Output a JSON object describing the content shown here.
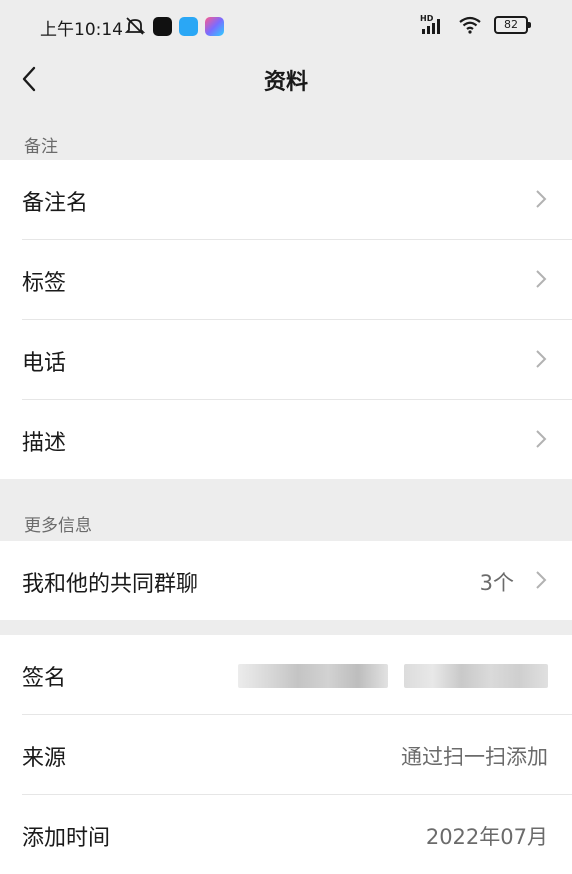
{
  "status": {
    "time": "上午10:14",
    "network": "HD",
    "battery": "82"
  },
  "nav": {
    "title": "资料"
  },
  "section_remark": {
    "header": "备注",
    "items": [
      {
        "label": "备注名"
      },
      {
        "label": "标签"
      },
      {
        "label": "电话"
      },
      {
        "label": "描述"
      }
    ]
  },
  "section_more": {
    "header": "更多信息",
    "common_groups": {
      "label": "我和他的共同群聊",
      "value": "3个"
    }
  },
  "section_info": {
    "signature": {
      "label": "签名"
    },
    "source": {
      "label": "来源",
      "value": "通过扫一扫添加"
    },
    "added_time": {
      "label": "添加时间",
      "value": "2022年07月"
    }
  },
  "colors": {
    "background": "#ededed",
    "card": "#ffffff",
    "secondary_text": "#6b6b6b"
  }
}
